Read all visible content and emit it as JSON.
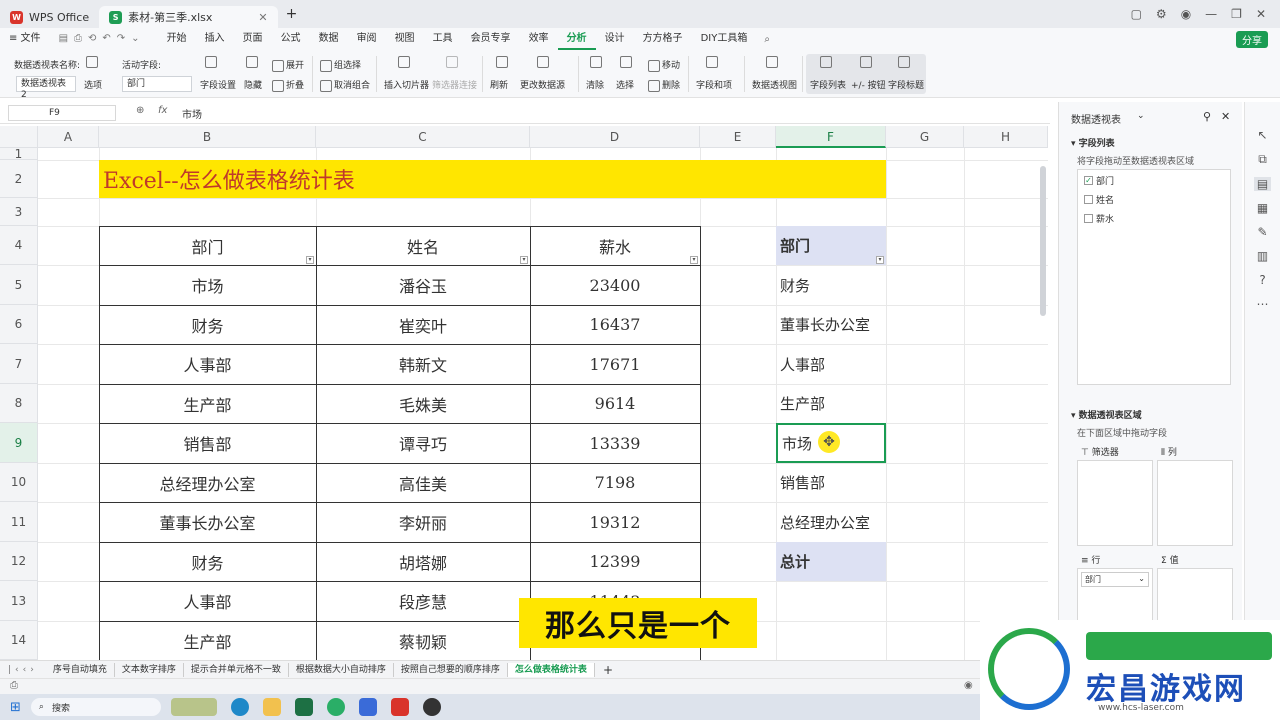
{
  "titlebar": {
    "tabs": [
      {
        "label": "WPS Office",
        "logo": "W"
      },
      {
        "label": "素材-第三季.xlsx",
        "logo": "S"
      }
    ],
    "new_tab": "+"
  },
  "menubar": {
    "file": "≡ 文件",
    "items": [
      "开始",
      "插入",
      "页面",
      "公式",
      "数据",
      "审阅",
      "视图",
      "工具",
      "会员专享",
      "效率",
      "分析",
      "设计",
      "方方格子",
      "DIY工具箱"
    ],
    "active": "分析",
    "share": "分享"
  },
  "toolbar": {
    "pivot_name_label": "数据透视表名称:",
    "pivot_name_value": "数据透视表2",
    "options": "选项",
    "active_field_label": "活动字段:",
    "active_field_value": "部门",
    "field_settings": "字段设置",
    "hide": "隐藏",
    "expand": "展开",
    "collapse": "折叠",
    "group_select": "组选择",
    "ungroup": "取消组合",
    "insert_slicer": "插入切片器",
    "filter_conn": "筛选器连接",
    "refresh": "刷新",
    "change_source": "更改数据源",
    "clear": "清除",
    "select": "选择",
    "move": "移动",
    "delete": "删除",
    "fields_items": "字段和项",
    "pivot_chart": "数据透视图",
    "field_list": "字段列表",
    "plus_minus": "+/- 按钮",
    "field_headers": "字段标题"
  },
  "formula": {
    "cell_ref": "F9",
    "fx": "fx",
    "value": "市场"
  },
  "sheet": {
    "columns": [
      "A",
      "B",
      "C",
      "D",
      "E",
      "F",
      "G",
      "H"
    ],
    "rows": [
      "1",
      "2",
      "3",
      "4",
      "5",
      "6",
      "7",
      "8",
      "9",
      "10",
      "11",
      "12",
      "13",
      "14"
    ],
    "title": "Excel--怎么做表格统计表",
    "headers": [
      "部门",
      "姓名",
      "薪水"
    ],
    "data": [
      [
        "市场",
        "潘谷玉",
        "23400"
      ],
      [
        "财务",
        "崔奕叶",
        "16437"
      ],
      [
        "人事部",
        "韩新文",
        "17671"
      ],
      [
        "生产部",
        "毛姝美",
        "9614"
      ],
      [
        "销售部",
        "谭寻巧",
        "13339"
      ],
      [
        "总经理办公室",
        "高佳美",
        "7198"
      ],
      [
        "董事长办公室",
        "李妍丽",
        "19312"
      ],
      [
        "财务",
        "胡塔娜",
        "12399"
      ],
      [
        "人事部",
        "段彦慧",
        "11443"
      ],
      [
        "生产部",
        "蔡韧颖",
        ""
      ]
    ],
    "pivot_header": "部门",
    "pivot_items": [
      "财务",
      "董事长办公室",
      "人事部",
      "生产部",
      "市场",
      "销售部",
      "总经理办公室"
    ],
    "pivot_total": "总计"
  },
  "subtitle": "那么只是一个",
  "panel": {
    "title": "数据透视表",
    "field_list_title": "字段列表",
    "field_hint": "将字段拖动至数据透视表区域",
    "fields": [
      {
        "name": "部门",
        "checked": true
      },
      {
        "name": "姓名",
        "checked": false
      },
      {
        "name": "薪水",
        "checked": false
      }
    ],
    "areas_title": "数据透视表区域",
    "areas_hint": "在下面区域中拖动字段",
    "filter": "筛选器",
    "column": "列",
    "row": "行",
    "value": "值",
    "row_field": "部门"
  },
  "sheettabs": [
    "序号自动填充",
    "文本数字排序",
    "提示合并单元格不一致",
    "根据数据大小自动排序",
    "按照自己想要的顺序排序",
    "怎么做表格统计表"
  ],
  "active_sheet": "怎么做表格统计表",
  "taskbar": {
    "search": "搜索"
  },
  "watermark": {
    "text": "宏昌游戏网",
    "url": "www.hcs-laser.com"
  },
  "colors": {
    "accent": "#1a9c53",
    "title_fill": "#ffe600",
    "pivot_fill": "#dde1f3"
  }
}
